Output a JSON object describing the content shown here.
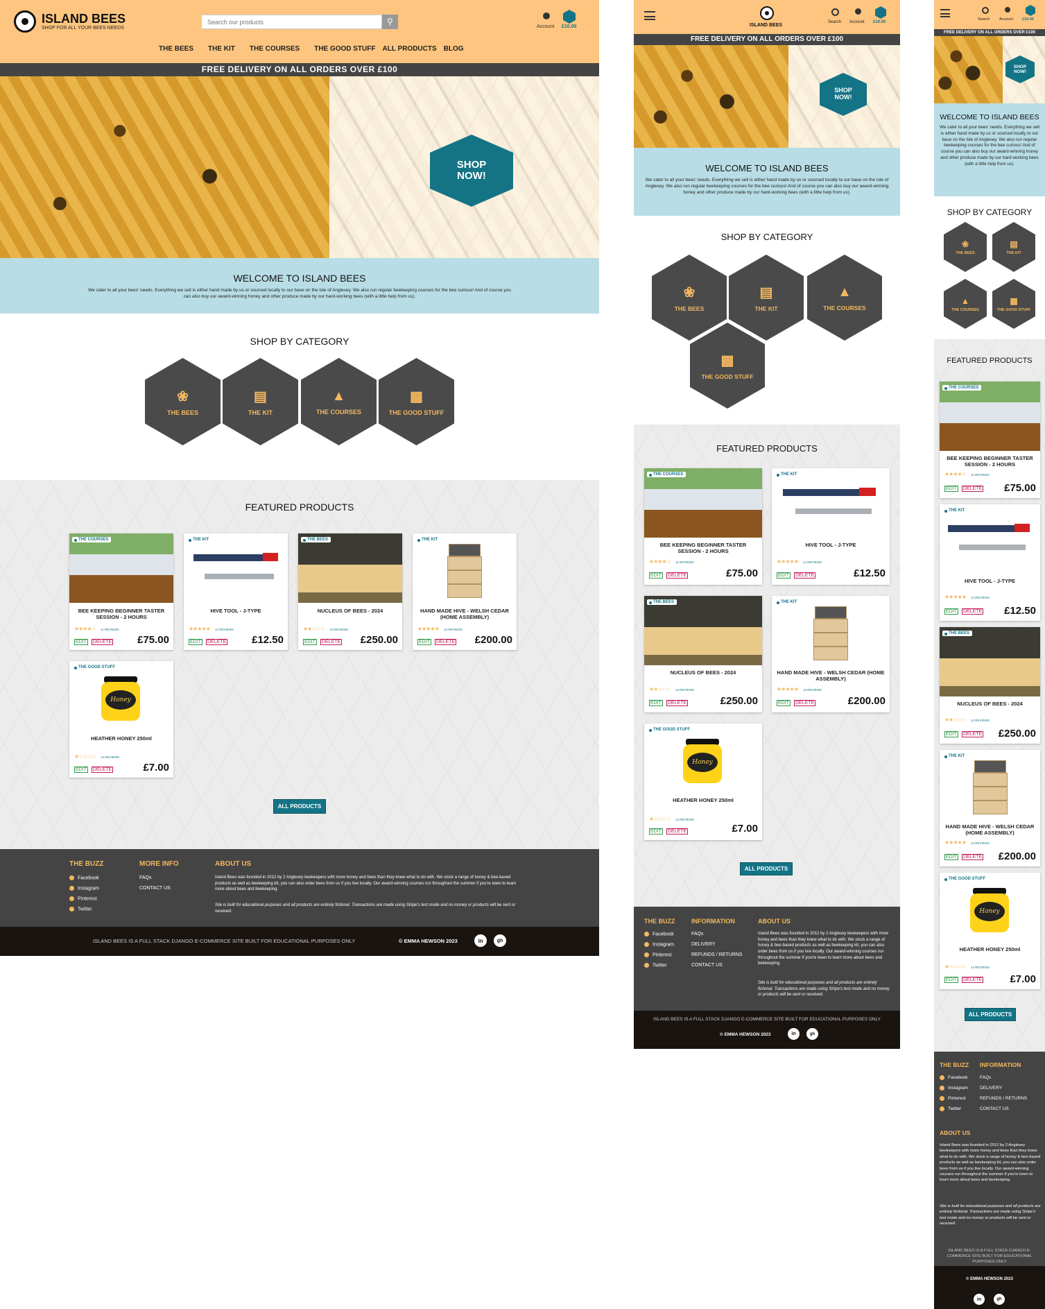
{
  "brand": {
    "name": "ISLAND BEES",
    "tagline": "SHOP FOR ALL YOUR BEES NEEDS"
  },
  "search": {
    "placeholder": "Search our products",
    "label": "Search"
  },
  "account": {
    "label": "Account"
  },
  "bag": {
    "total": "£10.00"
  },
  "nav": [
    "THE BEES",
    "THE KIT",
    "THE COURSES",
    "THE GOOD STUFF",
    "ALL PRODUCTS",
    "BLOG"
  ],
  "banner": "FREE DELIVERY ON ALL ORDERS OVER £100",
  "hero": {
    "cta_line1": "SHOP",
    "cta_line2": "NOW!"
  },
  "welcome": {
    "title": "WELCOME TO ISLAND BEES",
    "text": "We cater to all your bees' needs. Everything we sell is either hand made by us or sourced locally to our base on the Isle of Anglesey. We also run regular beekeeping courses for the bee curious! And of course you can also buy our award-winning honey and other produce made by our hard-working bees (with a little help from us)."
  },
  "categories": {
    "title": "SHOP BY CATEGORY",
    "items": [
      {
        "label": "THE BEES",
        "icon": "bee-icon"
      },
      {
        "label": "THE KIT",
        "icon": "box-icon"
      },
      {
        "label": "THE COURSES",
        "icon": "graduation-cap-icon"
      },
      {
        "label": "THE GOOD STUFF",
        "icon": "jar-icon"
      }
    ]
  },
  "featured": {
    "title": "FEATURED PRODUCTS",
    "edit": "EDIT",
    "delete": "DELETE",
    "button": "ALL PRODUCTS",
    "products": [
      {
        "category": "THE COURSES",
        "name": "BEE KEEPING BEGINNER TASTER SESSION - 2 HOURS",
        "stars": "★★★★☆",
        "reviews": "11 REVIEWS",
        "price": "£75.00"
      },
      {
        "category": "THE KIT",
        "name": "HIVE TOOL - J-TYPE",
        "stars": "★★★★★",
        "reviews": "14 REVIEWS",
        "price": "£12.50"
      },
      {
        "category": "THE BEES",
        "name": "NUCLEUS OF BEES - 2024",
        "stars": "★★☆☆☆",
        "reviews": "14 REVIEWS",
        "price": "£250.00"
      },
      {
        "category": "THE KIT",
        "name": "HAND MADE HIVE - WELSH CEDAR (HOME ASSEMBLY)",
        "stars": "★★★★★",
        "reviews": "13 REVIEWS",
        "price": "£200.00"
      },
      {
        "category": "THE GOOD STUFF",
        "name": "HEATHER HONEY 250ml",
        "stars": "★☆☆☆☆",
        "reviews": "14 REVIEWS",
        "price": "£7.00"
      }
    ]
  },
  "footer": {
    "buzz_title": "THE BUZZ",
    "social": [
      "Facebook",
      "Instagram",
      "Pinterest",
      "Twitter"
    ],
    "more_info_title": "MORE INFO",
    "info_title": "INFORMATION",
    "info_links_desktop": [
      "FAQs",
      "CONTACT US"
    ],
    "info_links": [
      "FAQs",
      "DELIVERY",
      "REFUNDS / RETURNS",
      "CONTACT US"
    ],
    "about_title": "ABOUT US",
    "about_text": "Island Bees was founded in 2012 by 2 Anglesey beekeepers with more honey and bees than they knew what to do with. We stock a range of honey & bee-based products as well as beekeeping kit, you can also order bees from us if you live locally. Our award-winning courses run throughout the summer if you're keen to learn more about bees and beekeeping.",
    "disclaimer": "Site is built for educational purposes and all products are entirely fictional. Transactions are made using Stripe's test mode and no money or products will be sent or received.",
    "bottom_text": "ISLAND BEES IS A FULL STACK DJANGO E-COMMERCE SITE BUILT FOR EDUCATIONAL PURPOSES ONLY",
    "copyright": "© EMMA HEWSON 2023",
    "linkedin": "in",
    "github": "gh"
  }
}
